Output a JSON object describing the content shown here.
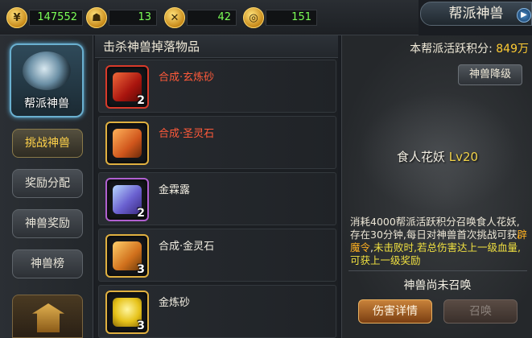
{
  "currencies": [
    {
      "icon": "gold-coin-icon",
      "value": "147552"
    },
    {
      "icon": "beast-head-icon",
      "value": "13"
    },
    {
      "icon": "crossed-swords-icon",
      "value": "42"
    },
    {
      "icon": "medal-icon",
      "value": "151"
    }
  ],
  "title": "帮派神兽",
  "sidebar": {
    "beast_tab_label": "帮派神兽",
    "buttons": [
      "挑战神兽",
      "奖励分配",
      "神兽奖励",
      "神兽榜"
    ]
  },
  "list": {
    "header": "击杀神兽掉落物品",
    "items": [
      {
        "name": "合成·玄炼砂",
        "count": "2"
      },
      {
        "name": "合成·圣灵石",
        "count": ""
      },
      {
        "name": "金霖露",
        "count": "2"
      },
      {
        "name": "合成·金灵石",
        "count": "3"
      },
      {
        "name": "金炼砂",
        "count": "3"
      }
    ]
  },
  "right": {
    "activity_label": "本帮派活跃积分:",
    "activity_value": "849万",
    "downgrade_label": "神兽降级",
    "beast_name": "食人花妖",
    "beast_level": "Lv20",
    "desc_part1": "消耗4000帮派活跃积分召唤食人花妖,存在30分钟,每日对神兽首次挑战可获",
    "desc_hl1": "辟魔令",
    "desc_part2": ",",
    "desc_hl2": "未击败时,若总伤害达上一级血量,可获上一级奖励",
    "status": "神兽尚未召唤",
    "damage_btn": "伤害详情",
    "summon_btn": "召唤"
  }
}
